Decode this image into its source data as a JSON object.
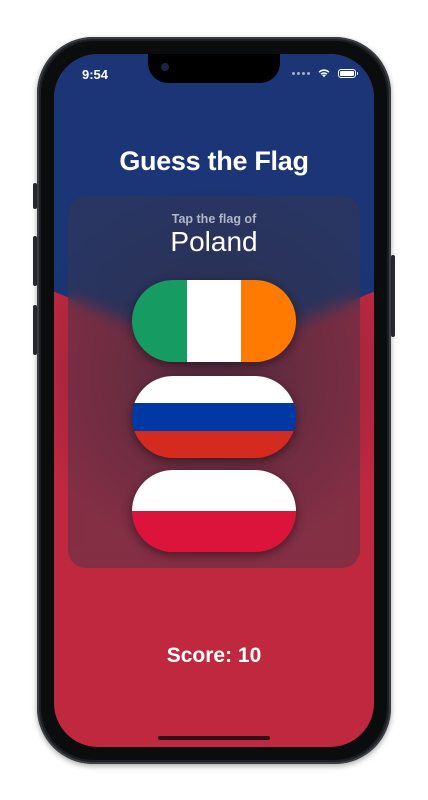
{
  "status_bar": {
    "time": "9:54",
    "icons": [
      "cellular-dots-icon",
      "wifi-icon",
      "battery-icon"
    ]
  },
  "app": {
    "title": "Guess the Flag",
    "prompt": "Tap the flag of",
    "country": "Poland",
    "score_label": "Score: 10"
  },
  "flags": [
    {
      "name": "Ireland",
      "colors": [
        "#169b62",
        "#ffffff",
        "#ff7a00"
      ],
      "orientation": "vertical"
    },
    {
      "name": "Russia",
      "colors": [
        "#ffffff",
        "#0039a6",
        "#d52b1e"
      ],
      "orientation": "horizontal"
    },
    {
      "name": "Poland",
      "colors": [
        "#ffffff",
        "#dc143c"
      ],
      "orientation": "horizontal"
    }
  ],
  "colors": {
    "background_top": "#1b3576",
    "background_bottom": "#c0283f",
    "text": "#ffffff"
  }
}
